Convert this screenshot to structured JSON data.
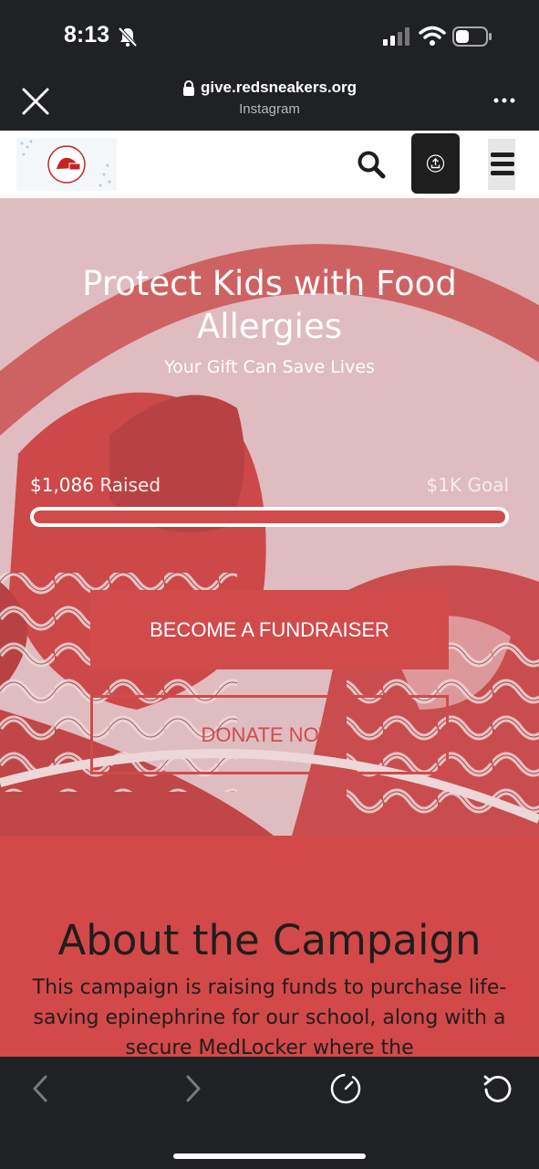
{
  "status_bar": {
    "time": "8:13"
  },
  "browser": {
    "url": "give.redsneakers.org",
    "source": "Instagram"
  },
  "hero": {
    "title": "Protect Kids with Food Allergies",
    "subtitle": "Your Gift Can Save Lives",
    "raised_amount": "$1,086",
    "raised_label": "Raised",
    "goal": "$1K Goal",
    "progress_fraction": 1.0,
    "fundraiser_button": "BECOME A FUNDRAISER",
    "donate_button": "DONATE NOW"
  },
  "about": {
    "title": "About the Campaign",
    "text": "This campaign is raising funds to purchase life-saving epinephrine for our school, along with a secure MedLocker where the"
  },
  "colors": {
    "brand_red": "#d14b4b",
    "hero_bg": "#dcb9bd",
    "about_bg": "#d34848",
    "chrome_dark": "#202124"
  },
  "icons": {
    "status": [
      "bell-slash-icon",
      "signal-icon",
      "wifi-icon",
      "battery-icon"
    ],
    "browser": [
      "close-icon",
      "lock-icon",
      "more-icon"
    ],
    "nav": [
      "search-icon",
      "share-icon",
      "hamburger-menu-icon"
    ],
    "toolbar": [
      "back-icon",
      "forward-icon",
      "speed-icon",
      "reload-icon"
    ]
  }
}
